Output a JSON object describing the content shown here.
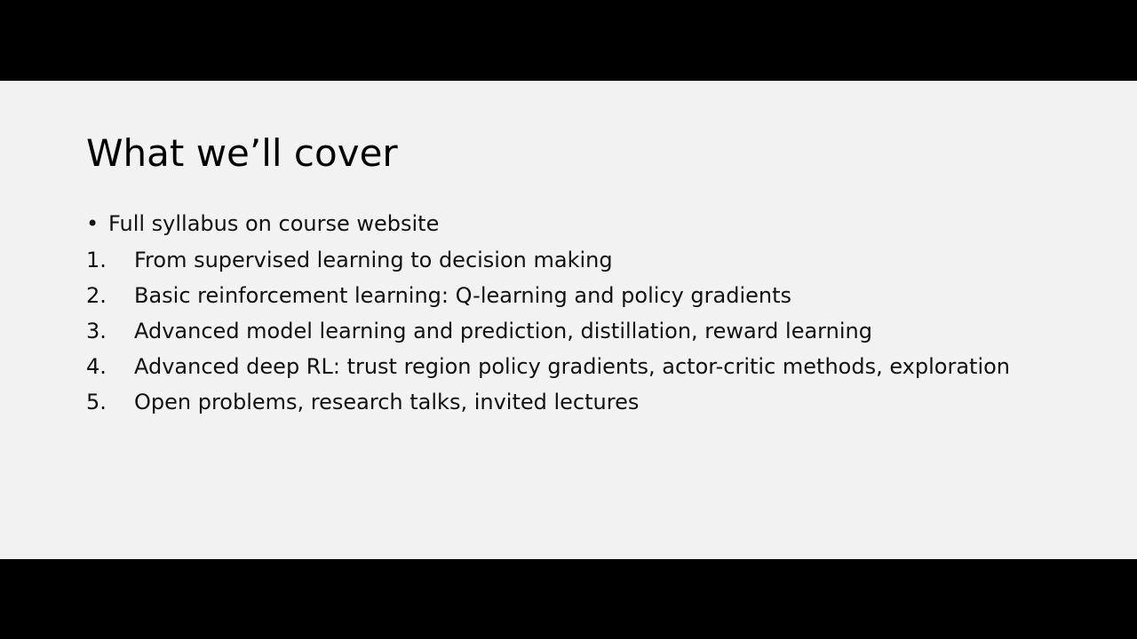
{
  "slide": {
    "title": "What we’ll cover",
    "bullet": {
      "marker": "•",
      "text": "Full syllabus on course website"
    },
    "numbered_items": [
      {
        "number": "1.",
        "text": "From supervised learning to decision making"
      },
      {
        "number": "2.",
        "text": "Basic reinforcement learning: Q-learning and policy gradients"
      },
      {
        "number": "3.",
        "text": "Advanced model learning and prediction, distillation, reward learning"
      },
      {
        "number": "4.",
        "text": "Advanced deep RL: trust region policy gradients, actor-critic methods, exploration"
      },
      {
        "number": "5.",
        "text": "Open problems, research talks, invited lectures"
      }
    ]
  },
  "colors": {
    "letterbox": "#000000",
    "slide_background": "#f2f2f2",
    "text": "#111111"
  }
}
